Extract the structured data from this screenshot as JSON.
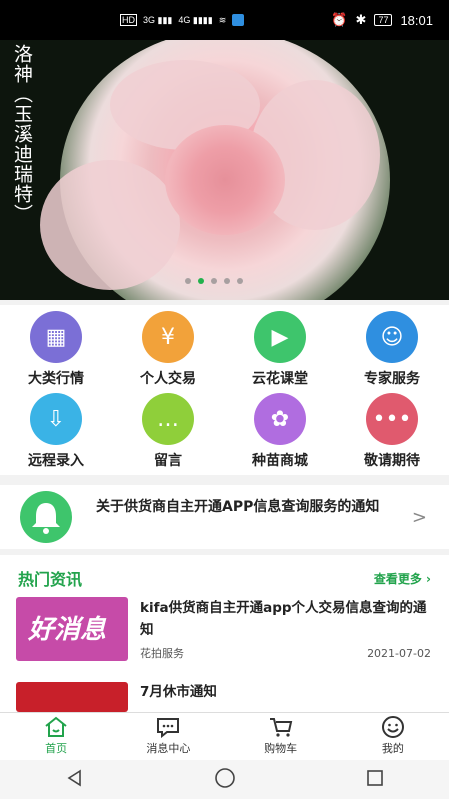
{
  "status_bar": {
    "left_icons": [
      "HD",
      "3G",
      "4G",
      "wifi",
      "app"
    ],
    "right_icons": [
      "alarm",
      "bluetooth"
    ],
    "battery": "77",
    "time": "18:01"
  },
  "banner": {
    "title": "洛神（玉溪迪瑞特）",
    "slide_count": 5,
    "active_slide": 1
  },
  "categories": [
    {
      "label": "大类行情",
      "icon": "market-icon",
      "color": "#7b6fd6"
    },
    {
      "label": "个人交易",
      "icon": "money-bag-icon",
      "color": "#f2a23a"
    },
    {
      "label": "云花课堂",
      "icon": "video-play-icon",
      "color": "#3ec56c"
    },
    {
      "label": "专家服务",
      "icon": "expert-icon",
      "color": "#2f8fe0"
    },
    {
      "label": "远程录入",
      "icon": "monitor-download-icon",
      "color": "#3ab3e6"
    },
    {
      "label": "留言",
      "icon": "chat-bubble-icon",
      "color": "#8fcf3a"
    },
    {
      "label": "种苗商城",
      "icon": "flower-icon",
      "color": "#b06de0"
    },
    {
      "label": "敬请期待",
      "icon": "more-dots-icon",
      "color": "#e05a6e"
    }
  ],
  "notice": {
    "text": "关于供货商自主开通APP信息查询服务的通知"
  },
  "hot_news": {
    "title": "热门资讯",
    "more_label": "查看更多",
    "items": [
      {
        "title": "kifa供货商自主开通app个人交易信息查询的通知",
        "source": "花拍服务",
        "date": "2021-07-02",
        "thumb_text": "好消息"
      },
      {
        "title": "7月休市通知",
        "source": "",
        "date": "",
        "thumb_text": ""
      }
    ]
  },
  "tabs": [
    {
      "label": "首页",
      "icon": "home-icon",
      "active": true
    },
    {
      "label": "消息中心",
      "icon": "message-icon",
      "active": false
    },
    {
      "label": "购物车",
      "icon": "cart-icon",
      "active": false
    },
    {
      "label": "我的",
      "icon": "profile-icon",
      "active": false
    }
  ],
  "accent_color": "#22a34c"
}
